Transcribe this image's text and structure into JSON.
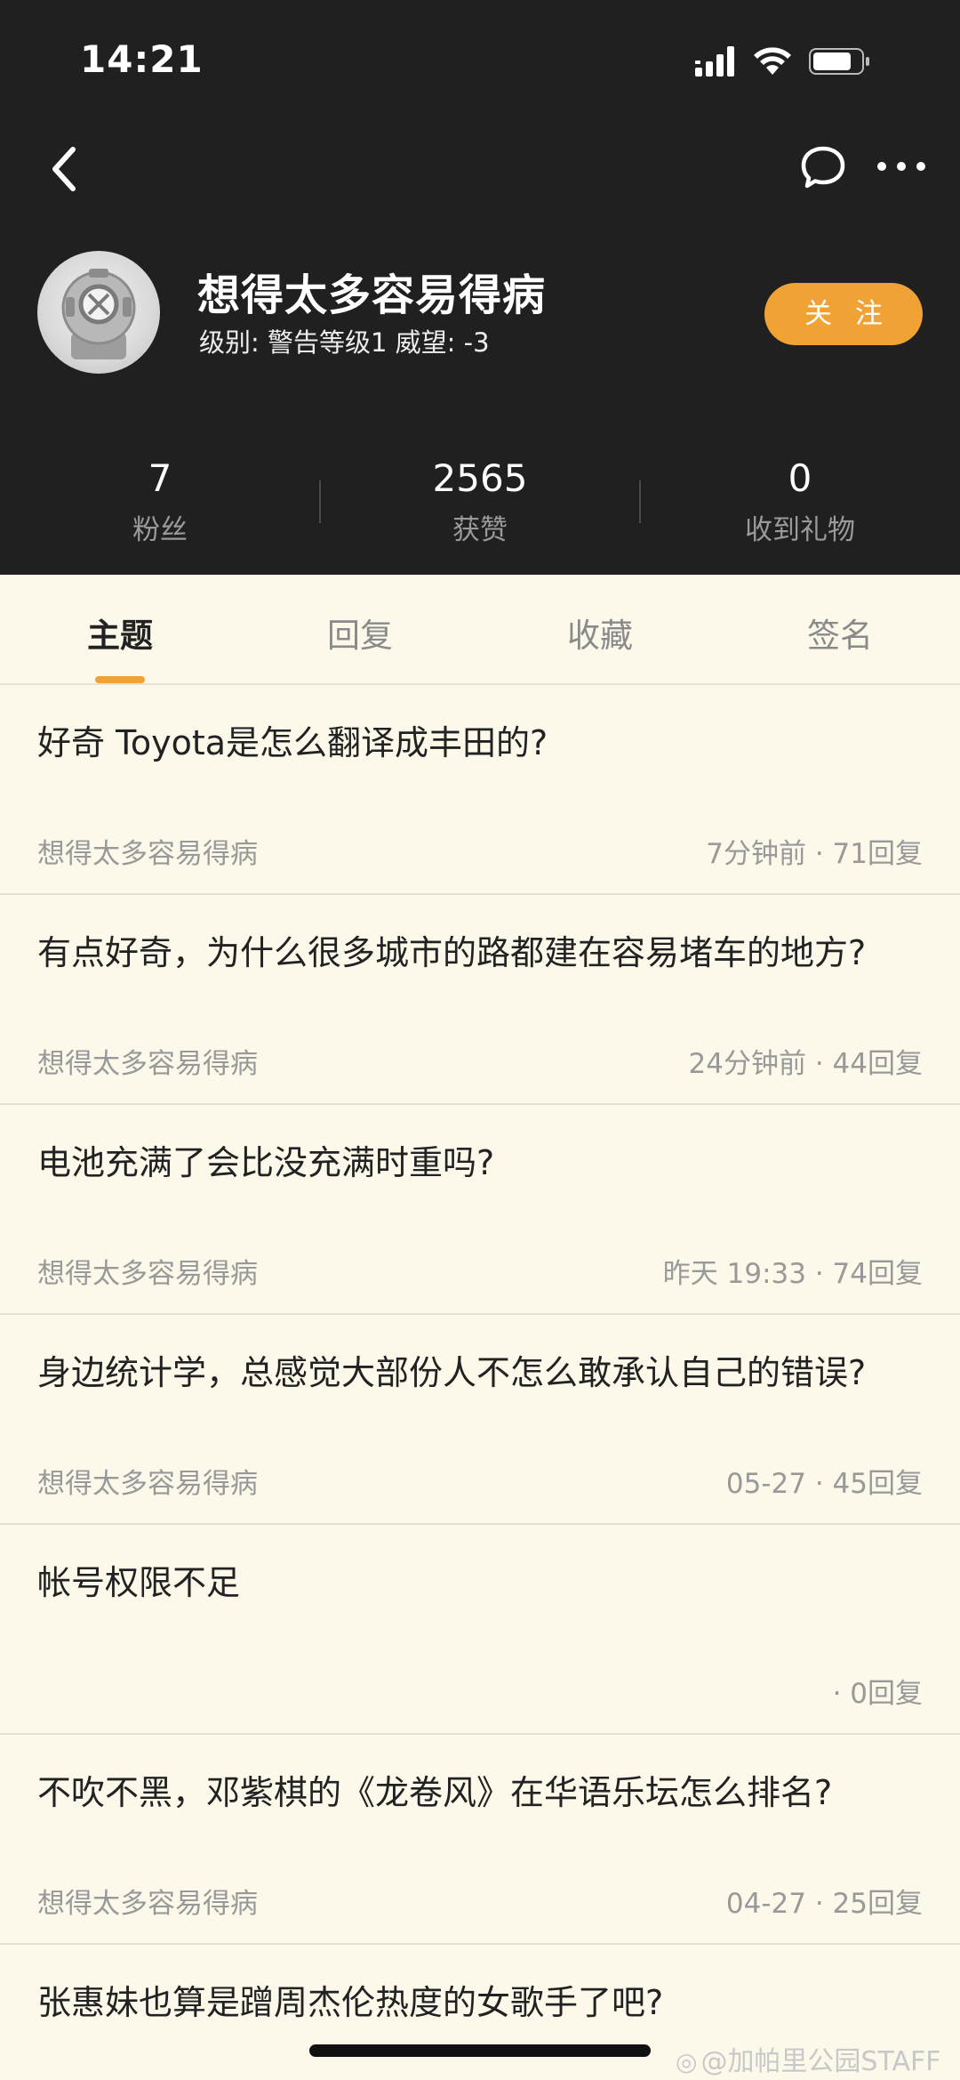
{
  "status_bar": {
    "time": "14:21",
    "icons": [
      "cellular-signal-icon",
      "wifi-icon",
      "battery-icon"
    ]
  },
  "nav": {
    "icons": [
      "back-arrow-icon",
      "chat-bubble-icon",
      "more-dots-icon"
    ]
  },
  "profile": {
    "username": "想得太多容易得病",
    "level_text": "级别: 警告等级1 威望: -3",
    "avatar_icon": "diving-helmet-avatar",
    "follow_label": "关 注"
  },
  "stats": [
    {
      "value": "7",
      "label": "粉丝"
    },
    {
      "value": "2565",
      "label": "获赞"
    },
    {
      "value": "0",
      "label": "收到礼物"
    }
  ],
  "tabs": [
    {
      "label": "主题",
      "active": true
    },
    {
      "label": "回复",
      "active": false
    },
    {
      "label": "收藏",
      "active": false
    },
    {
      "label": "签名",
      "active": false
    }
  ],
  "posts": [
    {
      "title": "好奇 Toyota是怎么翻译成丰田的?",
      "author": "想得太多容易得病",
      "meta": "7分钟前 · 71回复"
    },
    {
      "title": "有点好奇，为什么很多城市的路都建在容易堵车的地方?",
      "author": "想得太多容易得病",
      "meta": "24分钟前 · 44回复"
    },
    {
      "title": "电池充满了会比没充满时重吗?",
      "author": "想得太多容易得病",
      "meta": "昨天 19:33 · 74回复"
    },
    {
      "title": "身边统计学，总感觉大部份人不怎么敢承认自己的错误?",
      "author": "想得太多容易得病",
      "meta": "05-27 · 45回复"
    },
    {
      "title": "帐号权限不足",
      "author": "",
      "meta": "· 0回复"
    },
    {
      "title": "不吹不黑，邓紫棋的《龙卷风》在华语乐坛怎么排名?",
      "author": "想得太多容易得病",
      "meta": "04-27 · 25回复"
    },
    {
      "title": "张惠妹也算是蹭周杰伦热度的女歌手了吧?",
      "author": "",
      "meta": ""
    }
  ],
  "watermark": "@加帕里公园STAFF",
  "colors": {
    "header_bg": "#202020",
    "accent": "#f0a235",
    "page_bg": "#fcf9ea"
  }
}
